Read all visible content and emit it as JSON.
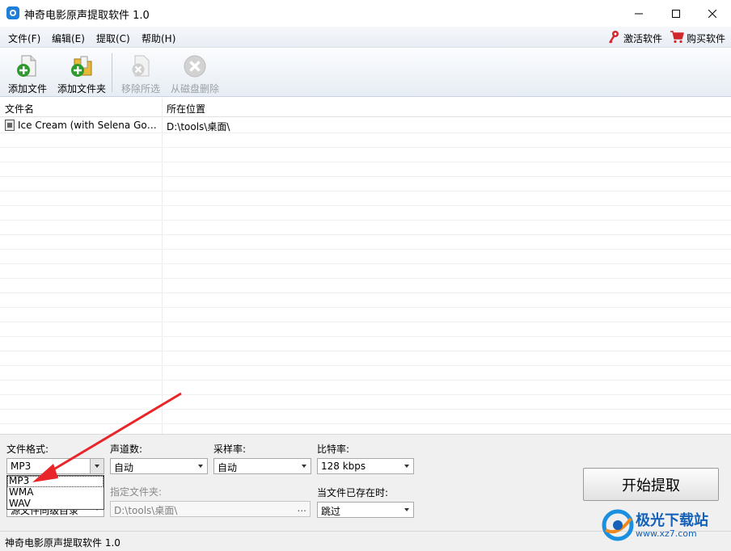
{
  "window": {
    "title": "神奇电影原声提取软件 1.0",
    "controls": {
      "minimize": "minimize-icon",
      "maximize": "maximize-icon",
      "close": "close-icon"
    }
  },
  "menu": {
    "file": "文件(F)",
    "edit": "编辑(E)",
    "extract": "提取(C)",
    "help": "帮助(H)",
    "activate": "激活软件",
    "buy": "购买软件"
  },
  "toolbar": {
    "add_file": "添加文件",
    "add_folder": "添加文件夹",
    "remove_selected": "移除所选",
    "delete_from_disk": "从磁盘删除"
  },
  "list": {
    "columns": [
      "文件名",
      "所在位置"
    ],
    "rows": [
      {
        "name": "Ice Cream (with Selena Gome...",
        "location": "D:\\tools\\桌面\\"
      }
    ]
  },
  "settings": {
    "format_label": "文件格式:",
    "format_value": "MP3",
    "format_options": [
      "MP3",
      "WMA",
      "WAV"
    ],
    "channels_label": "声道数:",
    "channels_value": "自动",
    "sample_rate_label": "采样率:",
    "sample_rate_value": "自动",
    "bitrate_label": "比特率:",
    "bitrate_value": "128 kbps",
    "output_partial": "源文件同级目录",
    "folder_label": "指定文件夹:",
    "folder_value": "D:\\tools\\桌面\\",
    "browse": "...",
    "exists_label": "当文件已存在时:",
    "exists_value": "跳过",
    "start_button": "开始提取"
  },
  "status": {
    "text": "神奇电影原声提取软件 1.0"
  },
  "watermark": {
    "name": "极光下载站",
    "url": "www.xz7.com"
  },
  "colors": {
    "annotation_arrow": "#e8262a",
    "menu_accent": "#d0272d",
    "watermark": "#1561b8"
  }
}
